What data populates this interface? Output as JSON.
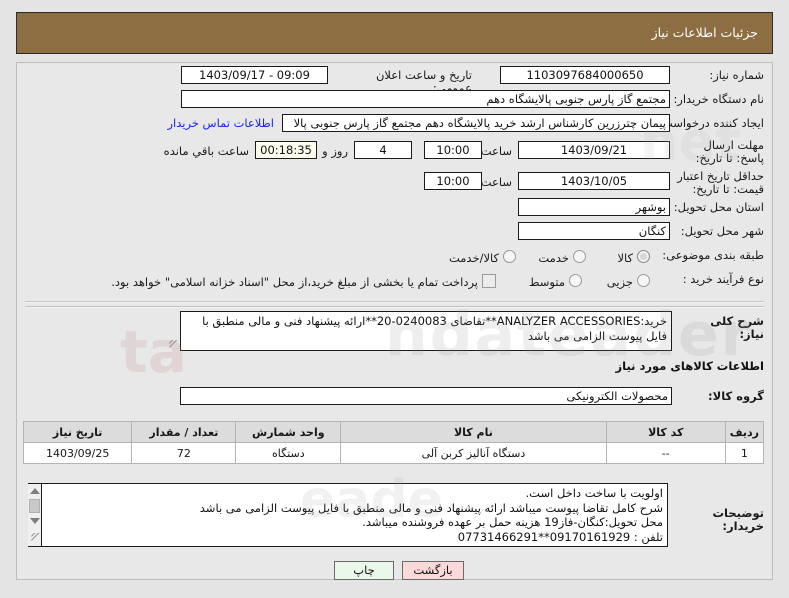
{
  "header": {
    "title": "جزئیات اطلاعات نیاز"
  },
  "form": {
    "need_number_label": "شماره نیاز:",
    "need_number_value": "1103097684000650",
    "announce_label": "تاریخ و ساعت اعلان عمومی:",
    "announce_value": "09:09 - 1403/09/17",
    "buyer_org_label": "نام دستگاه خریدار:",
    "buyer_org_value": "مجتمع گاز پارس جنوبی  پالایشگاه دهم",
    "requester_label": "ایجاد کننده درخواست:",
    "requester_value": "پیمان چترزرین کارشناس ارشد خرید پالایشگاه دهم مجتمع گاز پارس جنوبی  پالا",
    "contact_link": "اطلاعات تماس خریدار",
    "reply_deadline_label": "مهلت ارسال پاسخ: تا تاریخ:",
    "reply_deadline_date": "1403/09/21",
    "hour_label": "ساعت",
    "reply_deadline_time": "10:00",
    "remaining_days": "4",
    "days_and_label": "روز و",
    "remaining_clock": "00:18:35",
    "remaining_suffix": "ساعت باقي مانده",
    "price_valid_label": "حداقل تاریخ اعتبار قیمت: تا تاریخ:",
    "price_valid_date": "1403/10/05",
    "price_valid_time": "10:00",
    "province_label": "استان محل تحویل:",
    "province_value": "بوشهر",
    "city_label": "شهر محل تحویل:",
    "city_value": "کنگان",
    "category_label": "طبقه بندی موضوعی:",
    "category_options": [
      {
        "label": "کالا",
        "selected": true
      },
      {
        "label": "خدمت",
        "selected": false
      },
      {
        "label": "کالا/خدمت",
        "selected": false
      }
    ],
    "process_label": "نوع فرآیند خرید :",
    "process_options": [
      {
        "label": "جزیی",
        "selected": false
      },
      {
        "label": "متوسط",
        "selected": false
      }
    ],
    "treasury_checkbox_label": "پرداخت تمام یا بخشی از مبلغ خرید،از محل \"اسناد خزانه اسلامی\" خواهد بود.",
    "treasury_checked": false
  },
  "description": {
    "label": "شرح کلی نیاز:",
    "value": "خرید:ANALYZER ACCESSORIES**تقاضای 0240083-20**ارائه پیشنهاد فنی و مالی منطبق با فایل پیوست الزامی می باشد"
  },
  "goods": {
    "section_title": "اطلاعات کالاهای مورد نیاز",
    "group_label": "گروه کالا:",
    "group_value": "محصولات الکترونیکی",
    "columns": [
      "ردیف",
      "کد کالا",
      "نام کالا",
      "واحد شمارش",
      "تعداد / مقدار",
      "تاریخ نیاز"
    ],
    "rows": [
      {
        "row_no": "1",
        "code": "--",
        "name": "دستگاه آنالیز کربن آلی",
        "unit": "دستگاه",
        "quantity": "72",
        "need_date": "1403/09/25"
      }
    ]
  },
  "notes": {
    "label": "توضیحات خریدار:",
    "value": "اولویت با ساخت داخل است.\nشرح کامل تقاضا پیوست میباشد ارائه پیشنهاد فنی و مالی منطبق با فایل پیوست الزامی می باشد\nمحل تحویل:کنگان-فاز19 هزینه حمل بر عهده فروشنده میباشد.\nتلفن : 09170161929**07731466291"
  },
  "footer": {
    "print_label": "چاپ",
    "back_label": "بازگشت"
  },
  "watermark": {
    "line1": "ndateader",
    "line2": "ta",
    "line3": "eade",
    "line4": "net"
  },
  "colors": {
    "header_bg": "#8d6e43",
    "page_bg": "#e4e4e4",
    "panel_bg": "#e8e8e8",
    "link": "#1a25e8",
    "countdown_bg": "#fffff0",
    "print_btn": "#e9f8e9",
    "back_btn": "#fbd9d9"
  }
}
